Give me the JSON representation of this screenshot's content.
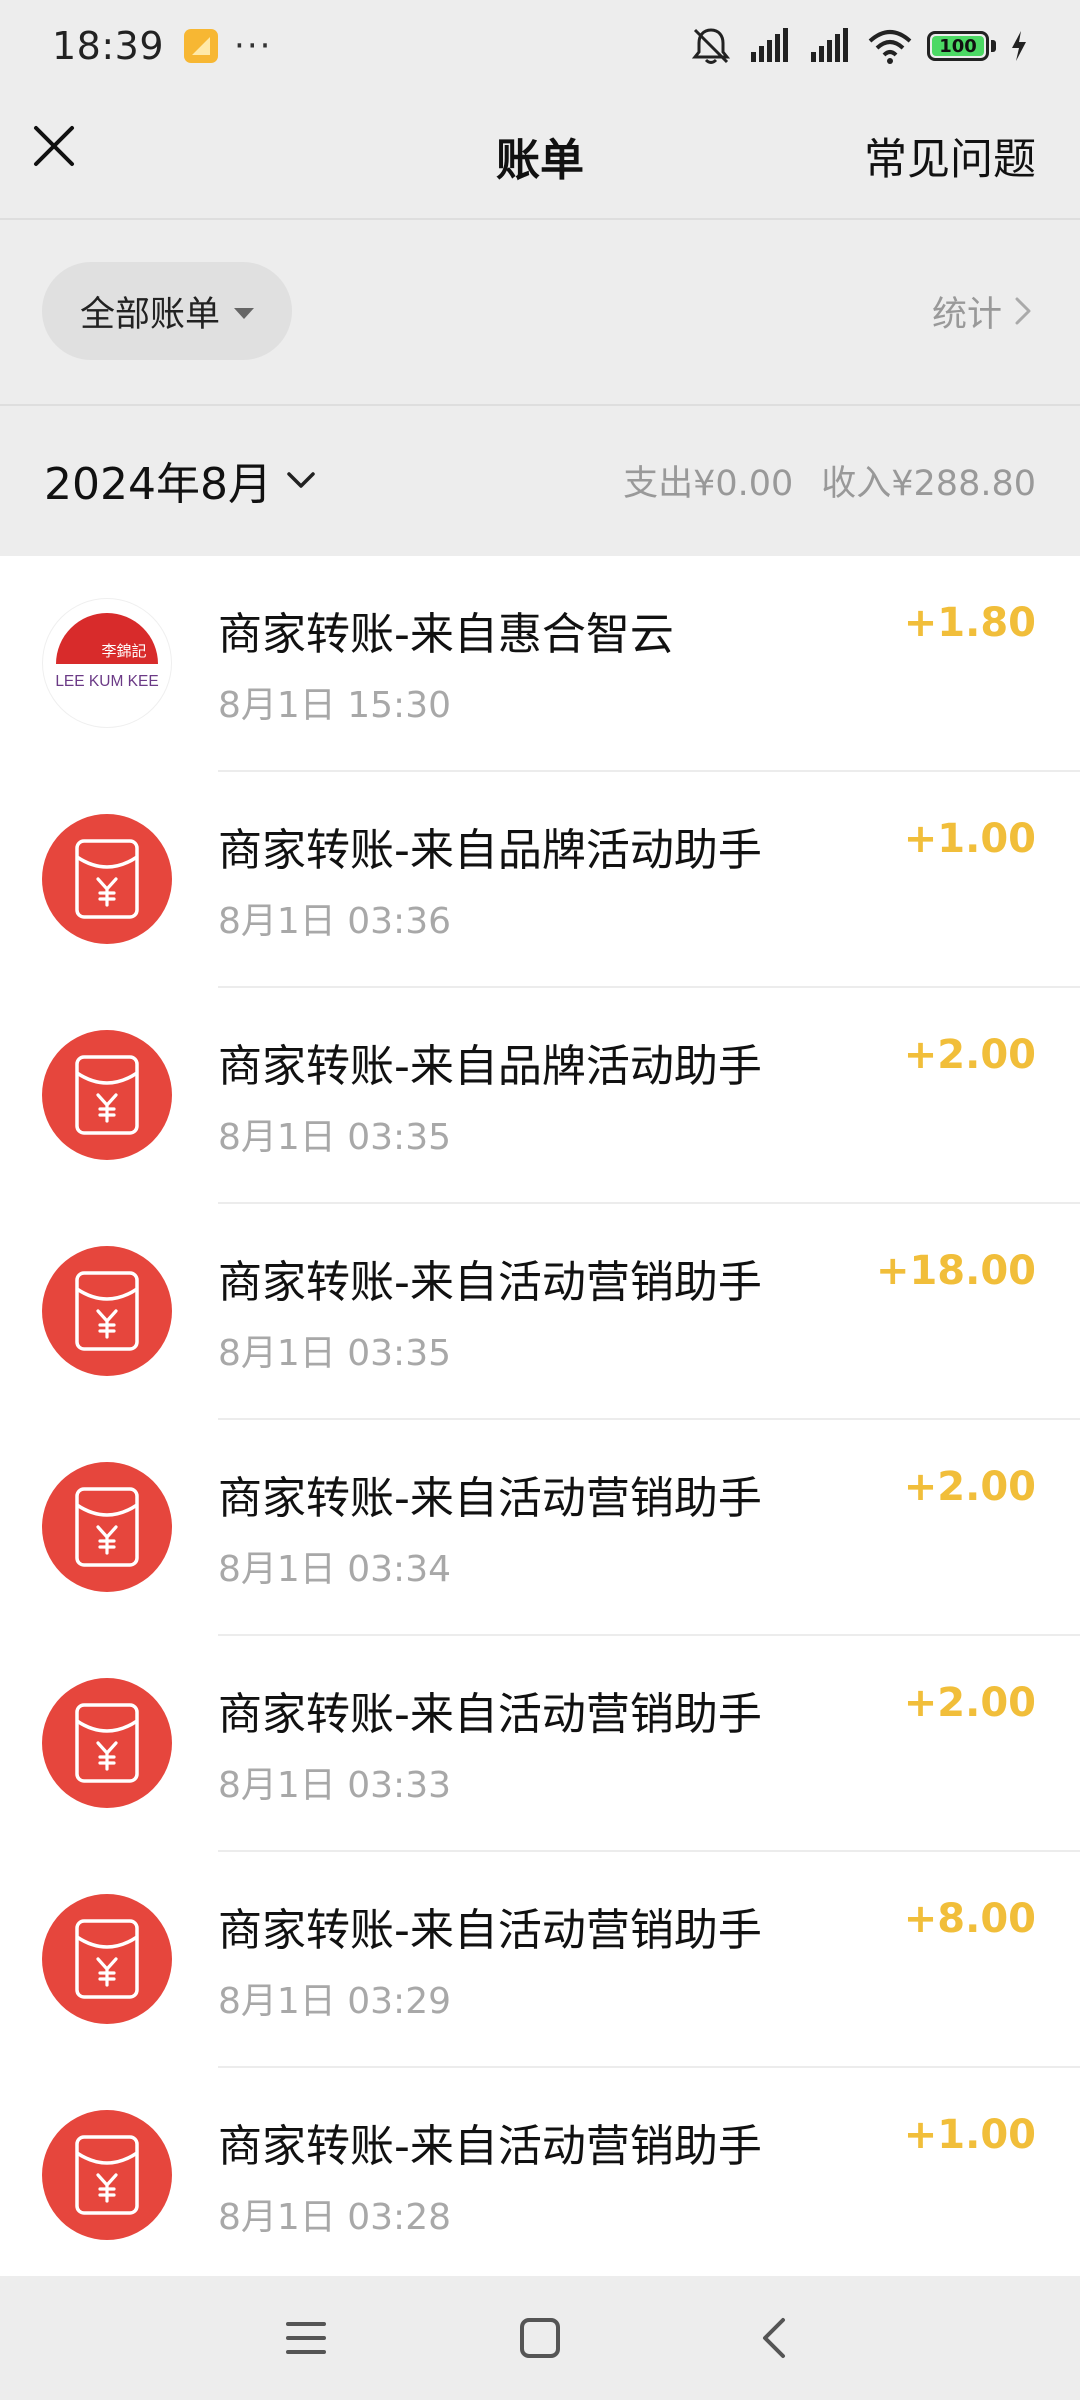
{
  "status_bar": {
    "time": "18:39",
    "more": "···",
    "battery": "100"
  },
  "header": {
    "title": "账单",
    "faq": "常见问题"
  },
  "filter": {
    "label": "全部账单",
    "stats": "统计"
  },
  "month": {
    "label": "2024年8月",
    "expense": "支出¥0.00",
    "income": "收入¥288.80"
  },
  "logo": {
    "chinese": "李錦記",
    "english": "LEE KUM KEE"
  },
  "bills": [
    {
      "title": "商家转账-来自惠合智云",
      "time": "8月1日 15:30",
      "amount": "+1.80",
      "avatar": "lee-kum-kee-logo"
    },
    {
      "title": "商家转账-来自品牌活动助手",
      "time": "8月1日 03:36",
      "amount": "+1.00",
      "avatar": "red-envelope-icon"
    },
    {
      "title": "商家转账-来自品牌活动助手",
      "time": "8月1日 03:35",
      "amount": "+2.00",
      "avatar": "red-envelope-icon"
    },
    {
      "title": "商家转账-来自活动营销助手",
      "time": "8月1日 03:35",
      "amount": "+18.00",
      "avatar": "red-envelope-icon"
    },
    {
      "title": "商家转账-来自活动营销助手",
      "time": "8月1日 03:34",
      "amount": "+2.00",
      "avatar": "red-envelope-icon"
    },
    {
      "title": "商家转账-来自活动营销助手",
      "time": "8月1日 03:33",
      "amount": "+2.00",
      "avatar": "red-envelope-icon"
    },
    {
      "title": "商家转账-来自活动营销助手",
      "time": "8月1日 03:29",
      "amount": "+8.00",
      "avatar": "red-envelope-icon"
    },
    {
      "title": "商家转账-来自活动营销助手",
      "time": "8月1日 03:28",
      "amount": "+1.00",
      "avatar": "red-envelope-icon"
    }
  ],
  "colors": {
    "amount": "#f1be3a",
    "envelope": "#e6463d",
    "background": "#ededed"
  }
}
